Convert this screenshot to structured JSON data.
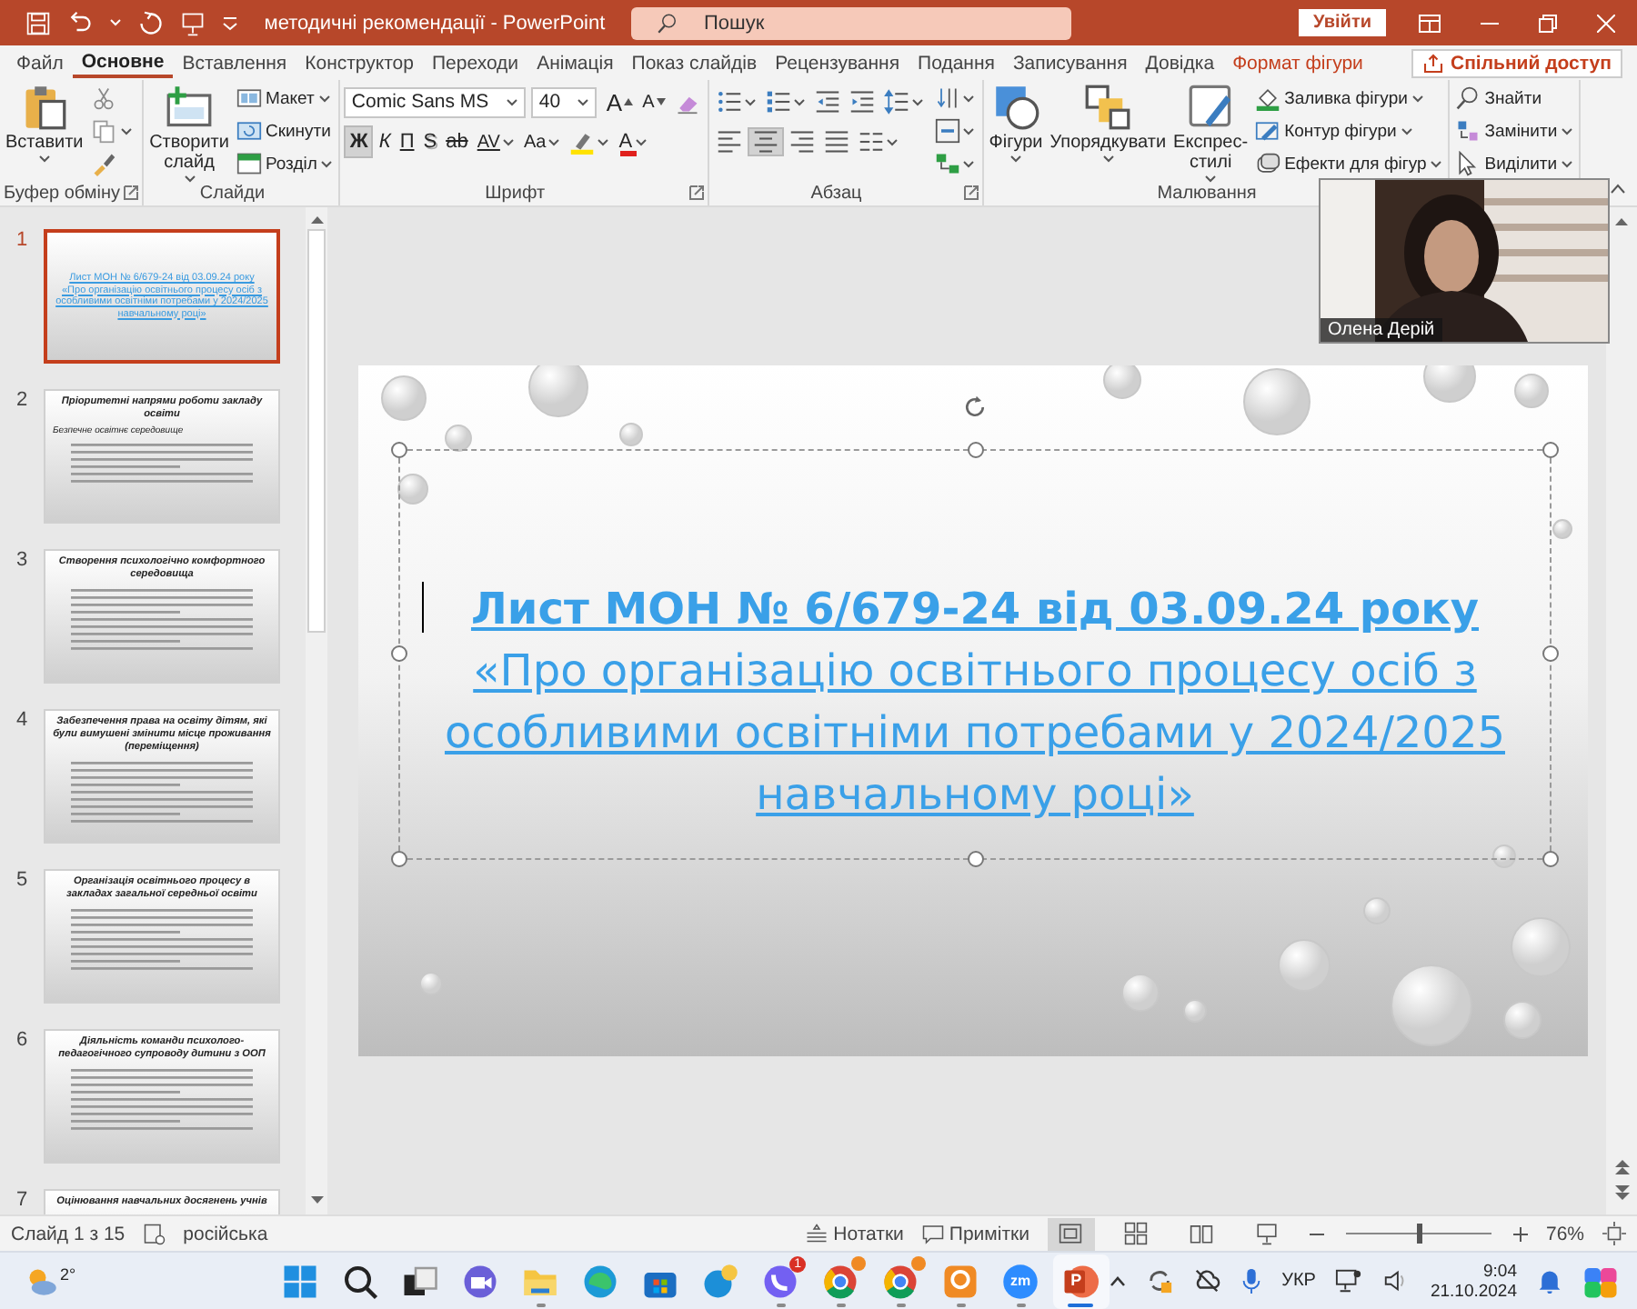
{
  "title_bar": {
    "title": "методичні рекомендації  -  PowerPoint",
    "search": {
      "placeholder": "Пошук"
    },
    "sign_in": "Увійти"
  },
  "tabs": [
    {
      "label": "Файл",
      "selected": false,
      "contextual": false
    },
    {
      "label": "Основне",
      "selected": true,
      "contextual": false
    },
    {
      "label": "Вставлення",
      "selected": false,
      "contextual": false
    },
    {
      "label": "Конструктор",
      "selected": false,
      "contextual": false
    },
    {
      "label": "Переходи",
      "selected": false,
      "contextual": false
    },
    {
      "label": "Анімація",
      "selected": false,
      "contextual": false
    },
    {
      "label": "Показ слайдів",
      "selected": false,
      "contextual": false
    },
    {
      "label": "Рецензування",
      "selected": false,
      "contextual": false
    },
    {
      "label": "Подання",
      "selected": false,
      "contextual": false
    },
    {
      "label": "Записування",
      "selected": false,
      "contextual": false
    },
    {
      "label": "Довідка",
      "selected": false,
      "contextual": false
    },
    {
      "label": "Формат фігури",
      "selected": false,
      "contextual": true
    }
  ],
  "share_button": "Спільний доступ",
  "ribbon": {
    "groups": [
      {
        "label": "Буфер обміну",
        "launcher": true,
        "items": [
          {
            "kind": "large",
            "label": "Вставити",
            "dropdown": true
          },
          {
            "kind": "stack",
            "items": [
              {
                "kind": "small",
                "dropdown": false
              },
              {
                "kind": "small",
                "dropdown": true
              },
              {
                "kind": "small",
                "dropdown": false
              }
            ]
          }
        ]
      },
      {
        "label": "Слайди",
        "launcher": false,
        "items": [
          {
            "kind": "large",
            "label": "Створити слайд",
            "dropdown": true
          },
          {
            "kind": "stack",
            "items": [
              {
                "kind": "small",
                "label": "Макет",
                "dropdown": true
              },
              {
                "kind": "small",
                "label": "Скинути",
                "dropdown": false
              },
              {
                "kind": "small",
                "label": "Розділ",
                "dropdown": true
              }
            ]
          }
        ]
      },
      {
        "label": "Шрифт",
        "launcher": true,
        "items": [
          {
            "kind": "stack",
            "items": [
              {
                "kind": "row",
                "items": [
                  {
                    "kind": "field",
                    "value": "Comic Sans MS"
                  },
                  {
                    "kind": "field",
                    "value": "40"
                  },
                  {
                    "kind": "grow",
                    "label": "A"
                  },
                  {
                    "kind": "shrink",
                    "label": "A"
                  },
                  {
                    "kind": "icon",
                    "dropdown": false,
                    "on": false
                  }
                ]
              },
              {
                "kind": "row",
                "items": [
                  {
                    "kind": "bold",
                    "label": "Ж",
                    "on": true
                  },
                  {
                    "kind": "italic",
                    "label": "К",
                    "on": false
                  },
                  {
                    "kind": "underline",
                    "label": "П",
                    "on": false
                  },
                  {
                    "kind": "shadow",
                    "label": "S",
                    "on": false
                  },
                  {
                    "kind": "strike",
                    "label": "ab",
                    "on": false
                  },
                  {
                    "kind": "spacing",
                    "label": "AV",
                    "dropdown": true
                  },
                  {
                    "kind": "case",
                    "label": "Aa",
                    "dropdown": true
                  },
                  {
                    "kind": "icon",
                    "dropdown": true,
                    "on": false
                  },
                  {
                    "kind": "fontcolor",
                    "label": "A",
                    "color": "#e0201c",
                    "dropdown": true
                  }
                ]
              }
            ]
          }
        ]
      },
      {
        "label": "Абзац",
        "launcher": true,
        "items": [
          {
            "kind": "stack",
            "items": [
              {
                "kind": "row",
                "items": [
                  {
                    "kind": "icon",
                    "dropdown": true,
                    "on": false
                  },
                  {
                    "kind": "icon",
                    "dropdown": true,
                    "on": false
                  },
                  {
                    "kind": "icon",
                    "dropdown": false,
                    "on": false
                  },
                  {
                    "kind": "icon",
                    "dropdown": false,
                    "on": false
                  },
                  {
                    "kind": "icon",
                    "dropdown": true,
                    "on": false
                  }
                ]
              },
              {
                "kind": "row",
                "items": [
                  {
                    "kind": "icon",
                    "dropdown": false,
                    "on": false
                  },
                  {
                    "kind": "icon",
                    "dropdown": false,
                    "on": true
                  },
                  {
                    "kind": "icon",
                    "dropdown": false,
                    "on": false
                  },
                  {
                    "kind": "icon",
                    "dropdown": false,
                    "on": false
                  },
                  {
                    "kind": "icon",
                    "dropdown": true,
                    "on": false
                  }
                ]
              }
            ]
          },
          {
            "kind": "stack",
            "items": [
              {
                "kind": "icon",
                "dropdown": true,
                "on": false
              },
              {
                "kind": "icon",
                "dropdown": true,
                "on": false
              },
              {
                "kind": "icon",
                "dropdown": true,
                "on": false
              }
            ]
          }
        ]
      },
      {
        "label": "Малювання",
        "launcher": false,
        "items": [
          {
            "kind": "large",
            "label": "Фігури",
            "dropdown": true
          },
          {
            "kind": "large",
            "label": "Упорядкувати",
            "dropdown": true
          },
          {
            "kind": "large",
            "label": "Експрес-стилі",
            "dropdown": true
          },
          {
            "kind": "stack",
            "items": [
              {
                "kind": "small",
                "label": "Заливка фігури",
                "dropdown": true
              },
              {
                "kind": "small",
                "label": "Контур фігури",
                "dropdown": true
              },
              {
                "kind": "small",
                "label": "Ефекти для фігур",
                "dropdown": true
              }
            ]
          }
        ]
      },
      {
        "launcher": false,
        "items": [
          {
            "kind": "stack",
            "items": [
              {
                "kind": "small",
                "label": "Знайти",
                "dropdown": false
              },
              {
                "kind": "small",
                "label": "Замінити",
                "dropdown": true
              },
              {
                "kind": "small",
                "label": "Виділити",
                "dropdown": true
              }
            ]
          }
        ]
      }
    ]
  },
  "slides_panel": {
    "slides": [
      {
        "number": "1",
        "selected": true,
        "kind": "title",
        "title": "Лист МОН № 6/679-24 від 03.09.24 року",
        "subtitle": "«Про організацію освітнього процесу осіб з особливими освітніми потребами у 2024/2025 навчальному році»"
      },
      {
        "number": "2",
        "selected": false,
        "kind": "content",
        "title": "Пріоритетні напрями роботи закладу освіти",
        "subtitle": "Безпечне освітнє середовище",
        "body": true
      },
      {
        "number": "3",
        "selected": false,
        "kind": "content",
        "title": "Створення психологічно комфортного середовища",
        "body": true
      },
      {
        "number": "4",
        "selected": false,
        "kind": "content",
        "title": "Забезпечення права на освіту дітям, які були вимушені змінити місце проживання (переміщення)",
        "body": true
      },
      {
        "number": "5",
        "selected": false,
        "kind": "content",
        "title": "Організація освітнього процесу в закладах загальної середньої освіти",
        "body": true
      },
      {
        "number": "6",
        "selected": false,
        "kind": "content",
        "title": "Діяльність команди психолого-педагогічного супроводу дитини з ООП",
        "body": true
      },
      {
        "number": "7",
        "selected": false,
        "kind": "content",
        "title": "Оцінювання навчальних досягнень учнів",
        "body": false
      }
    ]
  },
  "slide": {
    "title": "Лист МОН № 6/679-24 від 03.09.24 року",
    "subtitle": "«Про організацію освітнього процесу осіб з особливими освітніми потребами у 2024/2025 навчальному році»"
  },
  "video": {
    "name": "Олена Дерій"
  },
  "status_bar": {
    "slide": "Слайд 1 з 15",
    "language": "російська",
    "notes": "Нотатки",
    "comments": "Примітки",
    "views": [
      {
        "selected": true
      },
      {
        "selected": false
      },
      {
        "selected": false
      },
      {
        "selected": false
      }
    ],
    "zoom": {
      "level": 0.5,
      "reading": "76%"
    }
  },
  "taskbar": {
    "weather": "2°",
    "apps": [
      {
        "kind": "start",
        "running": false
      },
      {
        "kind": "search",
        "running": false
      },
      {
        "kind": "taskview",
        "running": false
      },
      {
        "kind": "meet",
        "running": false
      },
      {
        "kind": "explorer",
        "running": true
      },
      {
        "kind": "edge",
        "running": false
      },
      {
        "kind": "store",
        "running": false
      },
      {
        "kind": "helper",
        "running": false
      },
      {
        "kind": "viber",
        "running": true,
        "badge": "1"
      },
      {
        "kind": "chrome",
        "running": true
      },
      {
        "kind": "chrome",
        "running": true
      },
      {
        "kind": "orange",
        "running": true
      },
      {
        "kind": "zoom",
        "running": true,
        "label": "zm"
      },
      {
        "kind": "powerpoint",
        "running": true,
        "active": true,
        "label": "P"
      }
    ],
    "language": "УКР",
    "time": "9:04",
    "date": "21.10.2024"
  }
}
